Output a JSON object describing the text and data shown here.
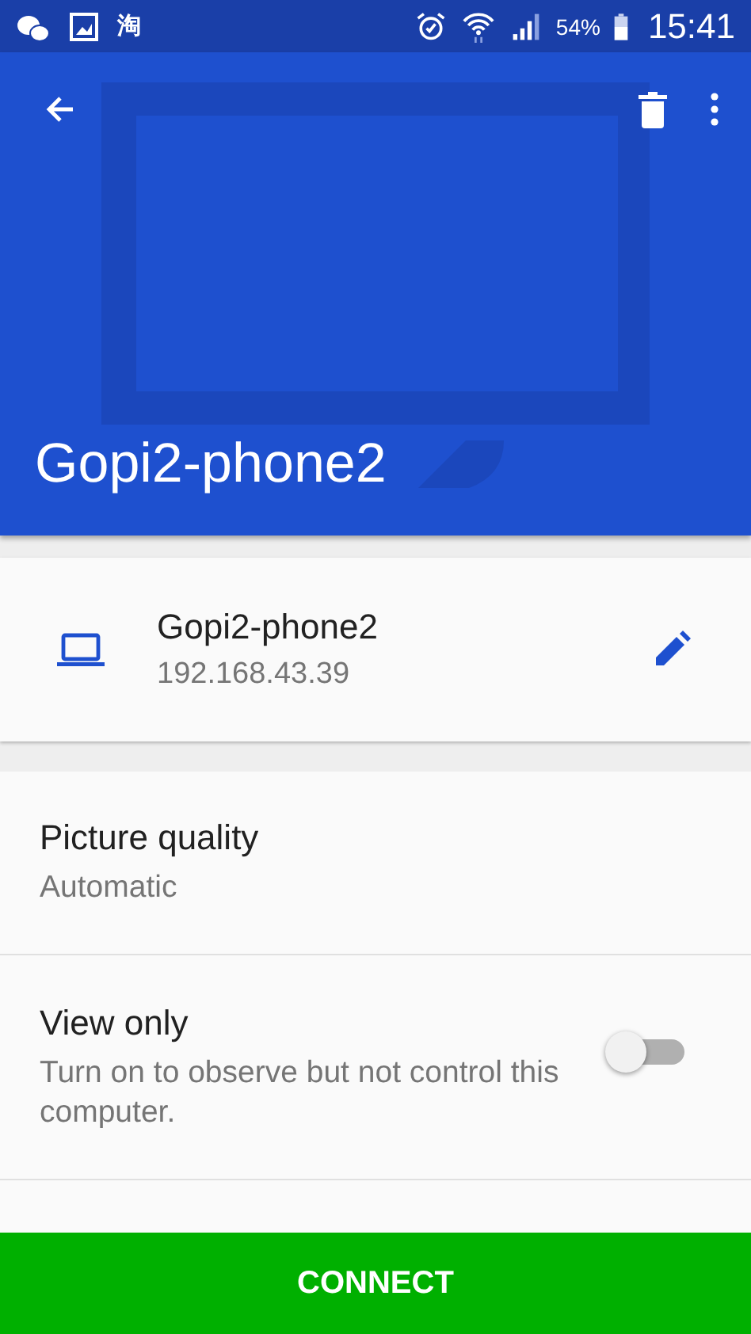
{
  "status_bar": {
    "app_glyph": "淘",
    "battery_text": "54%",
    "time": "15:41"
  },
  "header": {
    "title": "Gopi2-phone2"
  },
  "device": {
    "name": "Gopi2-phone2",
    "address": "192.168.43.39"
  },
  "settings": [
    {
      "kind": "value",
      "title": "Picture quality",
      "value": "Automatic"
    },
    {
      "kind": "switch",
      "title": "View only",
      "description": "Turn on to observe but not control this computer.",
      "on": false
    }
  ],
  "connect_button": {
    "label": "CONNECT"
  }
}
